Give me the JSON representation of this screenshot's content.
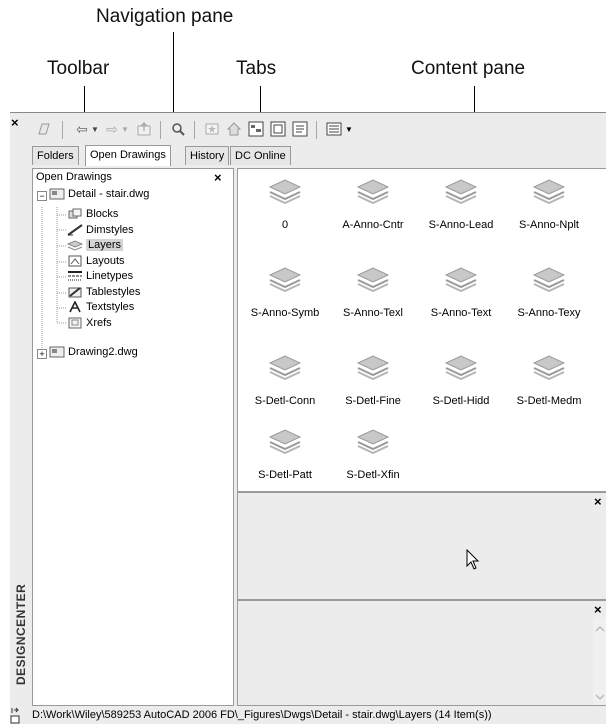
{
  "callouts": {
    "navigation_pane": "Navigation pane",
    "toolbar": "Toolbar",
    "tabs": "Tabs",
    "content_pane": "Content pane"
  },
  "window": {
    "side_title": "DESIGNCENTER",
    "close_glyph": "×"
  },
  "toolbar": {
    "buttons": [
      {
        "icon": "load-icon"
      },
      {
        "icon": "back-icon",
        "glyph": "⇦"
      },
      {
        "icon": "forward-icon",
        "glyph": "⇨"
      },
      {
        "icon": "up-icon"
      },
      {
        "icon": "search-icon"
      },
      {
        "icon": "favorites-icon"
      },
      {
        "icon": "home-icon"
      },
      {
        "icon": "tree-view-toggle-icon"
      },
      {
        "icon": "preview-icon"
      },
      {
        "icon": "description-icon"
      },
      {
        "icon": "views-icon"
      }
    ]
  },
  "tabs": [
    {
      "label": "Folders",
      "active": false
    },
    {
      "label": "Open Drawings",
      "active": true
    },
    {
      "label": "History",
      "active": false
    },
    {
      "label": "DC Online",
      "active": false
    }
  ],
  "nav": {
    "header": "Open Drawings",
    "close_glyph": "×",
    "tree": {
      "drawing1": "Detail - stair.dwg",
      "children": [
        "Blocks",
        "Dimstyles",
        "Layers",
        "Layouts",
        "Linetypes",
        "Tablestyles",
        "Textstyles",
        "Xrefs"
      ],
      "selected": "Layers",
      "drawing2": "Drawing2.dwg"
    }
  },
  "content": {
    "items": [
      "0",
      "A-Anno-Cntr",
      "S-Anno-Lead",
      "S-Anno-Nplt",
      "S-Anno-Symb",
      "S-Anno-Texl",
      "S-Anno-Text",
      "S-Anno-Texy",
      "S-Detl-Conn",
      "S-Detl-Fine",
      "S-Detl-Hidd",
      "S-Detl-Medm",
      "S-Detl-Patt",
      "S-Detl-Xfin"
    ]
  },
  "statusbar": {
    "path": "D:\\Work\\Wiley\\589253 AutoCAD 2006 FD\\_Figures\\Dwgs\\Detail - stair.dwg\\Layers (14 Item(s))"
  },
  "colors": {
    "layer_icon": "#9a9a9a",
    "selection": "#d4d4d4"
  }
}
